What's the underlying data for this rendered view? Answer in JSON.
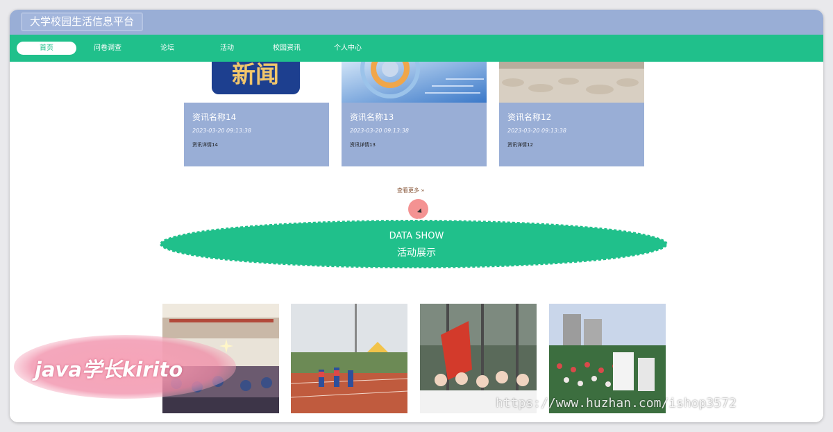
{
  "site": {
    "title": "大学校园生活信息平台"
  },
  "nav": {
    "items": [
      {
        "label": "首页",
        "active": true
      },
      {
        "label": "问卷调查"
      },
      {
        "label": "论坛"
      },
      {
        "label": "活动"
      },
      {
        "label": "校园资讯"
      },
      {
        "label": "个人中心"
      }
    ]
  },
  "news": {
    "cards": [
      {
        "name": "资讯名称14",
        "time": "2023-03-20 09:13:38",
        "detail": "资讯详情14",
        "image_text": "新闻"
      },
      {
        "name": "资讯名称13",
        "time": "2023-03-20 09:13:38",
        "detail": "资讯详情13"
      },
      {
        "name": "资讯名称12",
        "time": "2023-03-20 09:13:38",
        "detail": "资讯详情12"
      }
    ],
    "more_label": "查看更多 »"
  },
  "banner": {
    "en": "DATA SHOW",
    "cn": "活动展示"
  },
  "watermarks": {
    "author": "java学长kirito",
    "url": "https://www.huzhan.com/ishop3572"
  },
  "colors": {
    "titlebar": "#99aed6",
    "nav": "#20c08b",
    "card": "#99aed6"
  }
}
